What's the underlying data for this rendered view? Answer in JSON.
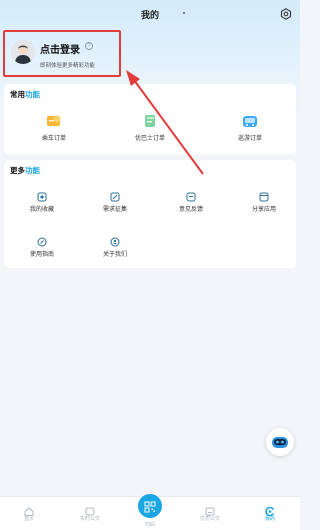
{
  "header": {
    "title": "我的"
  },
  "profile": {
    "login_title": "点击登录",
    "login_sub": "即刻体验更多精彩功能"
  },
  "common": {
    "title_prefix": "常用",
    "title_accent": "功能",
    "items": [
      {
        "label": "乘车订单",
        "icon": "ticket-icon"
      },
      {
        "label": "优巴士订单",
        "icon": "bus-order-icon"
      },
      {
        "label": "巡游订单",
        "icon": "tour-order-icon"
      }
    ]
  },
  "more": {
    "title_prefix": "更多",
    "title_accent": "功能",
    "items": [
      {
        "label": "我的收藏",
        "icon": "favorites-icon"
      },
      {
        "label": "需求征集",
        "icon": "demand-collection-icon"
      },
      {
        "label": "意见反馈",
        "icon": "feedback-icon"
      },
      {
        "label": "分享应用",
        "icon": "share-app-icon"
      },
      {
        "label": "使用指南",
        "icon": "guide-icon"
      },
      {
        "label": "关于我们",
        "icon": "about-icon"
      }
    ]
  },
  "tabbar": {
    "items": [
      {
        "label": "首页",
        "icon": "home-icon"
      },
      {
        "label": "实时公交",
        "icon": "realtime-bus-icon"
      },
      {
        "label": "扫码",
        "icon": "scan-icon"
      },
      {
        "label": "优质公交",
        "icon": "quality-bus-icon"
      },
      {
        "label": "我的",
        "icon": "profile-tab-icon"
      }
    ],
    "active_color": "#1ba6e4"
  },
  "colors": {
    "accent": "#1ba6e4",
    "highlight_box": "#e23c3c"
  }
}
